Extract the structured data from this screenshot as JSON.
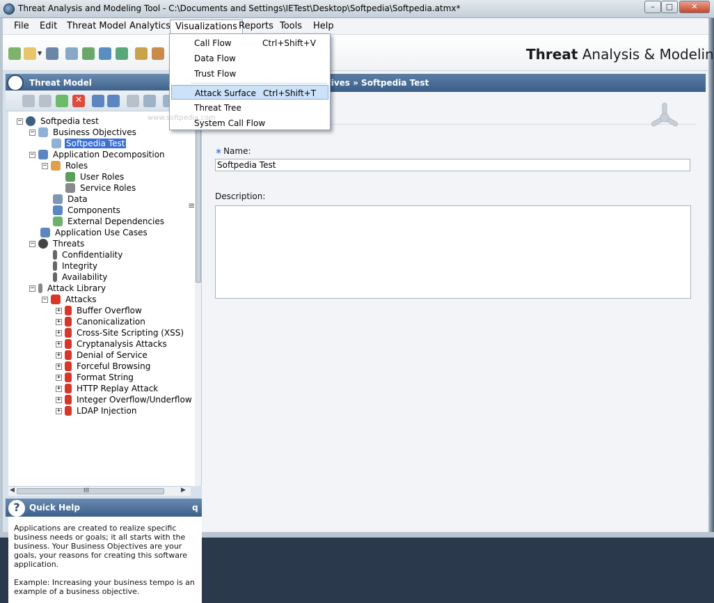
{
  "window": {
    "title": "Threat Analysis and Modeling Tool - C:\\Documents and Settings\\IETest\\Desktop\\Softpedia\\Softpedia.atmx*",
    "minimize": "–",
    "maximize": "□",
    "close": "✕"
  },
  "menubar": {
    "file": "File",
    "edit": "Edit",
    "threat_model": "Threat Model",
    "analytics": "Analytics",
    "visualizations": "Visualizations",
    "reports": "Reports",
    "tools": "Tools",
    "help": "Help"
  },
  "visualizations_menu": {
    "items": [
      {
        "label": "Call Flow",
        "shortcut": "Ctrl+Shift+V"
      },
      {
        "label": "Data Flow",
        "shortcut": ""
      },
      {
        "label": "Trust Flow",
        "shortcut": ""
      },
      {
        "label": "Attack Surface",
        "shortcut": "Ctrl+Shift+T"
      },
      {
        "label": "Threat Tree",
        "shortcut": ""
      },
      {
        "label": "System Call Flow",
        "shortcut": ""
      }
    ]
  },
  "brand": {
    "bold": "Threat",
    "rest": " Analysis & Modeling"
  },
  "left_panel": {
    "header": "Threat Model",
    "tree": [
      {
        "label": "Softpedia test",
        "expander": "−"
      },
      {
        "label": "Business Objectives",
        "expander": "−"
      },
      {
        "label": "Softpedia Test",
        "expander": ""
      },
      {
        "label": "Application Decomposition",
        "expander": "−"
      },
      {
        "label": "Roles",
        "expander": "−"
      },
      {
        "label": "User Roles",
        "expander": ""
      },
      {
        "label": "Service Roles",
        "expander": ""
      },
      {
        "label": "Data",
        "expander": ""
      },
      {
        "label": "Components",
        "expander": ""
      },
      {
        "label": "External Dependencies",
        "expander": ""
      },
      {
        "label": "Application Use Cases",
        "expander": ""
      },
      {
        "label": "Threats",
        "expander": "−"
      },
      {
        "label": "Confidentiality",
        "expander": ""
      },
      {
        "label": "Integrity",
        "expander": ""
      },
      {
        "label": "Availability",
        "expander": ""
      },
      {
        "label": "Attack Library",
        "expander": "−"
      },
      {
        "label": "Attacks",
        "expander": "−"
      },
      {
        "label": "Buffer Overflow",
        "expander": "+"
      },
      {
        "label": "Canonicalization",
        "expander": "+"
      },
      {
        "label": "Cross-Site Scripting (XSS)",
        "expander": "+"
      },
      {
        "label": "Cryptanalysis Attacks",
        "expander": "+"
      },
      {
        "label": "Denial of Service",
        "expander": "+"
      },
      {
        "label": "Forceful Browsing",
        "expander": "+"
      },
      {
        "label": "Format String",
        "expander": "+"
      },
      {
        "label": "HTTP Replay Attack",
        "expander": "+"
      },
      {
        "label": "Integer Overflow/Underflow",
        "expander": "+"
      },
      {
        "label": "LDAP Injection",
        "expander": "+"
      }
    ],
    "hscroll_grip": "III",
    "quick_help": {
      "title": "Quick Help",
      "collapse": "q",
      "para1": "Applications are created to realize specific business needs or goals; it all starts with the business. Your Business Objectives are your goals, your reasons for creating this software application.",
      "para2": "Example: Increasing your business tempo is an example of a business objective."
    }
  },
  "right_panel": {
    "breadcrumb": "tives » Softpedia Test",
    "name_label": "Name:",
    "name_required": "∗",
    "name_value": "Softpedia Test",
    "description_label": "Description:"
  },
  "watermark": "www.softpedia.com",
  "colors": {
    "accent": "#3b5f8a",
    "selection": "#3b6fd4",
    "menu_highlight": "#cbe2f9"
  }
}
